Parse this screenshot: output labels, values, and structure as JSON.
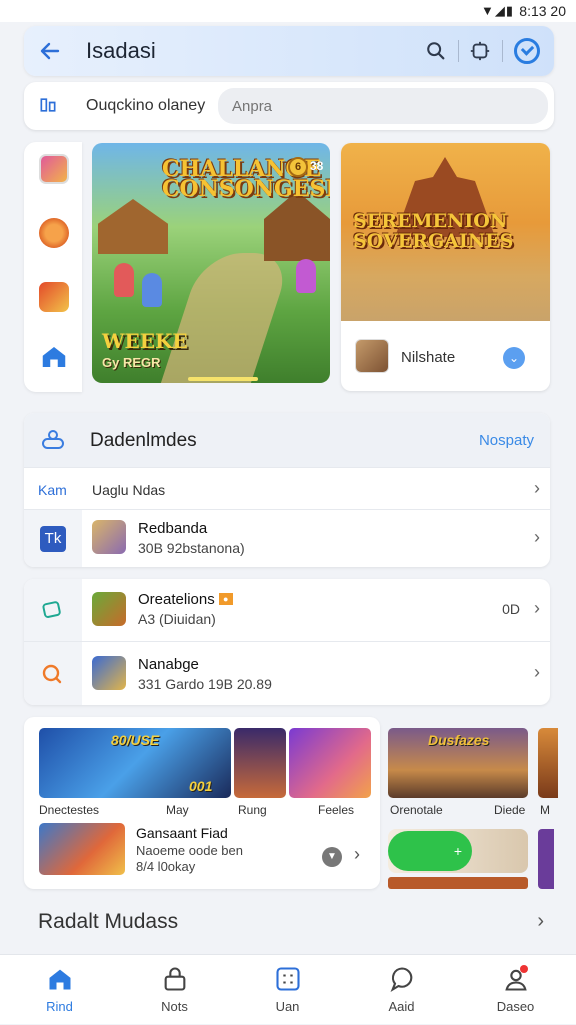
{
  "status_bar": {
    "glyphs": "▼◢▮",
    "time": "8:13 20"
  },
  "header": {
    "title": "Isadasi"
  },
  "search": {
    "label": "Ouqckino olaney",
    "placeholder": "Anpra"
  },
  "hero": {
    "main_logo": "CHALLANGE CONSONGESES",
    "main_coin": "6",
    "main_count": "38",
    "main_tag": "WEEKE",
    "main_tag2": "Gy REGR",
    "side_logo": "SEREMENION SOVERGAINES",
    "side_game_name": "Nilshate"
  },
  "list1": {
    "title": "Dadenlmdes",
    "link": "Nospaty",
    "row1_tag": "Kam",
    "row1_text": "Uaglu Ndas",
    "row2_icon": "Tk",
    "row2_title": "Redbanda",
    "row2_sub": "30B 92bstanona)"
  },
  "list2": {
    "row1_title": "Oreatelions",
    "row1_sub": "A3 (Diuidan)",
    "row1_right": "0D",
    "row2_title": "Nanabge",
    "row2_sub": "331 Gardo 19B 20.89"
  },
  "grid": {
    "tile1_num": "80/USE",
    "tile1_num2": "001",
    "labels": [
      "Dnectestes",
      "May",
      "Rung",
      "Feeles"
    ],
    "list_title": "Gansaant Fiad",
    "list_sub1": "Naoeme oode ben",
    "list_sub2": "8/4 l0okay"
  },
  "grid2": {
    "tile_title": "Dusfazes",
    "labels": [
      "Orenotale",
      "Diede",
      "M"
    ]
  },
  "section": {
    "title": "Radalt Mudass"
  },
  "nav": [
    {
      "label": "Rind"
    },
    {
      "label": "Nots"
    },
    {
      "label": "Uan"
    },
    {
      "label": "Aaid"
    },
    {
      "label": "Daseo"
    }
  ],
  "colors": {
    "accent": "#2d7be0",
    "badge": "#f19a2a",
    "green": "#2ec24a"
  }
}
